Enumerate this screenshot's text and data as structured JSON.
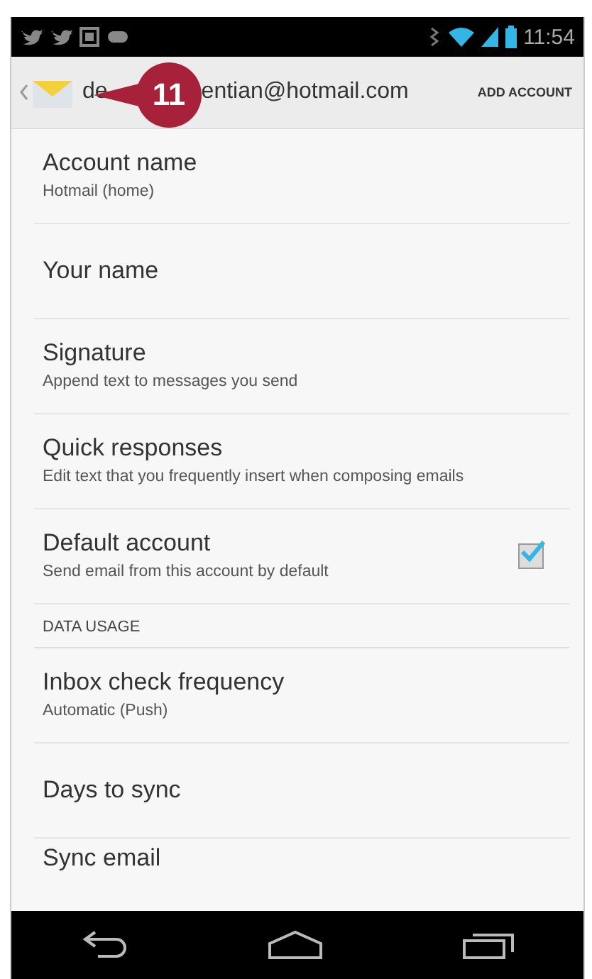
{
  "status_bar": {
    "time": "11:54"
  },
  "action_bar": {
    "title_start": "de",
    "title_end": "entian@hotmail.com",
    "action": "ADD ACCOUNT"
  },
  "callout": {
    "label": "11"
  },
  "settings": [
    {
      "kind": "setting",
      "title": "Account name",
      "summary": "Hotmail (home)"
    },
    {
      "kind": "setting",
      "title": "Your name"
    },
    {
      "kind": "setting",
      "title": "Signature",
      "summary": "Append text to messages you send"
    },
    {
      "kind": "setting",
      "title": "Quick responses",
      "summary": "Edit text that you frequently insert when composing emails"
    },
    {
      "kind": "checkbox",
      "title": "Default account",
      "summary": "Send email from this account by default",
      "checked": true
    },
    {
      "kind": "header",
      "title": "DATA USAGE"
    },
    {
      "kind": "setting",
      "title": "Inbox check frequency",
      "summary": "Automatic (Push)"
    },
    {
      "kind": "setting",
      "title": "Days to sync"
    },
    {
      "kind": "cut",
      "title": "Sync email"
    }
  ]
}
